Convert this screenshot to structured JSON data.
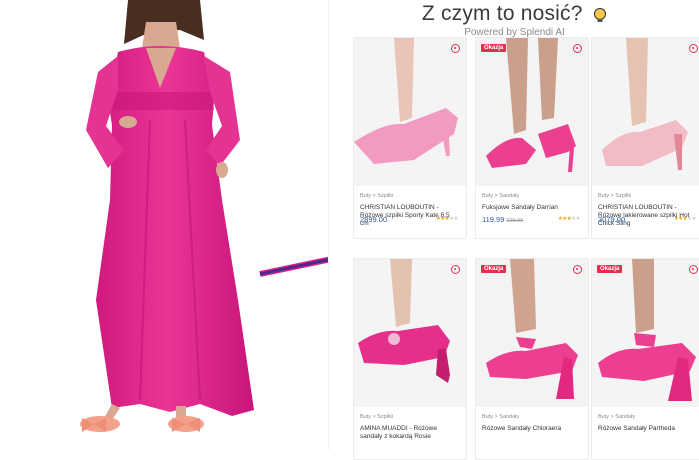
{
  "header": {
    "title": "Z czym to nosić?",
    "powered": "Powered by Splendi AI"
  },
  "products": [
    {
      "crumb": "Buty > Szpilki",
      "name": "CHRISTIAN LOUBOUTIN - Różowe szpilki Sporty Kate 8,5 cm",
      "price": "2899.00",
      "old_price": "",
      "badge": "",
      "rating": 3.5,
      "shoe_color": "#f39ac3"
    },
    {
      "crumb": "Buty > Sandały",
      "name": "Fuksjowe Sandały Darrian",
      "price": "119.99",
      "old_price": "229.99",
      "badge": "Okazja",
      "rating": 3.5,
      "shoe_color": "#ec3f8f"
    },
    {
      "crumb": "Buty > Szpilki",
      "name": "CHRISTIAN LOUBOUTIN - Różowe lakierowane szpilki Hot Chick Sling",
      "price": "3079.00",
      "old_price": "",
      "badge": "",
      "rating": 3.5,
      "shoe_color": "#f2bcc6"
    },
    {
      "crumb": "Buty > Szpilki",
      "name": "AMINA MUADDI - Różowe sandały z kokardą Rosie",
      "price": "",
      "old_price": "",
      "badge": "",
      "rating": 0,
      "shoe_color": "#e4308a"
    },
    {
      "crumb": "Buty > Sandały",
      "name": "Różowe Sandały Chloraera",
      "price": "",
      "old_price": "",
      "badge": "Okazja",
      "rating": 0,
      "shoe_color": "#ec3f8f"
    },
    {
      "crumb": "Buty > Sandały",
      "name": "Różowe Sandały Partheda",
      "price": "",
      "old_price": "",
      "badge": "Okazja",
      "rating": 0,
      "shoe_color": "#ec3f8f"
    }
  ],
  "colors": {
    "dress": "#e0208a",
    "accent": "#e0314e",
    "price": "#2b5aa8",
    "star": "#e6a11a",
    "arrow": "#4a2a8c"
  }
}
